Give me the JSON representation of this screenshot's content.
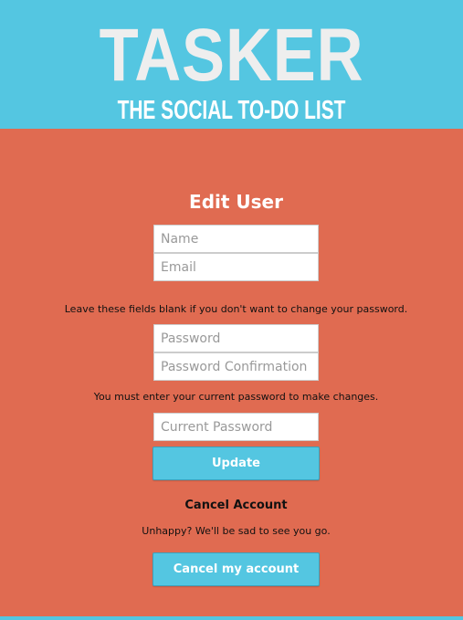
{
  "header": {
    "title": "TASKER",
    "subtitle": "THE SOCIAL TO-DO LIST"
  },
  "colors": {
    "header_bg": "#54c6e1",
    "page_bg": "#e06b51",
    "button_bg": "#54c6e1"
  },
  "form": {
    "title": "Edit User",
    "name_placeholder": "Name",
    "email_placeholder": "Email",
    "password_note": "Leave these fields blank if you don't want to change your password.",
    "password_placeholder": "Password",
    "password_confirmation_placeholder": "Password Confirmation",
    "current_password_note": "You must enter your current password to make changes.",
    "current_password_placeholder": "Current Password",
    "update_label": "Update"
  },
  "cancel": {
    "heading": "Cancel Account",
    "message": "Unhappy? We'll be sad to see you go.",
    "button_label": "Cancel my account"
  }
}
